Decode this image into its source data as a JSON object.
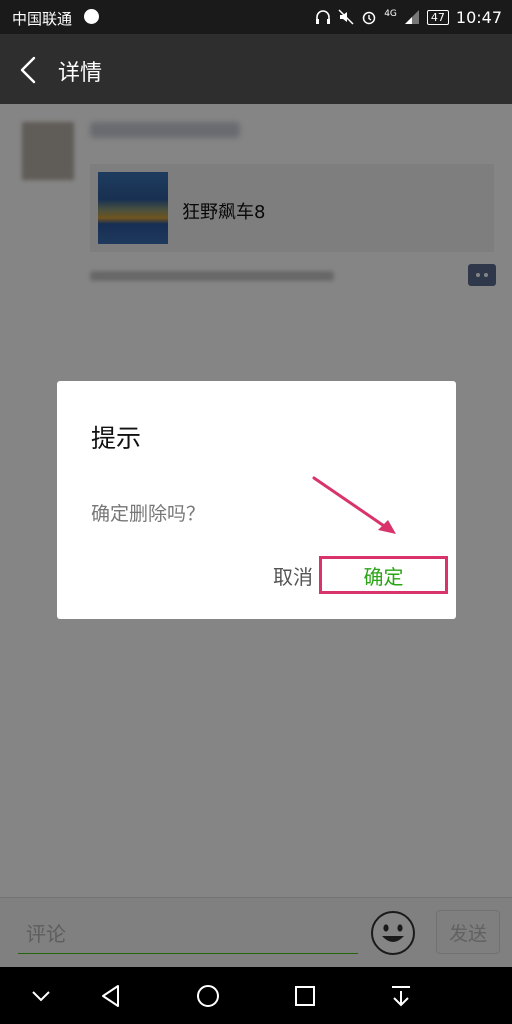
{
  "status_bar": {
    "carrier": "中国联通",
    "network_label": "4G",
    "battery": "47",
    "time": "10:47"
  },
  "header": {
    "title": "详情",
    "back_icon": "chevron-left-icon"
  },
  "post": {
    "share_title": "狂野飙车8"
  },
  "input_bar": {
    "placeholder": "评论",
    "send_label": "发送",
    "emoji_icon": "smiley-icon"
  },
  "dialog": {
    "title": "提示",
    "message": "确定删除吗？",
    "cancel_label": "取消",
    "confirm_label": "确定"
  },
  "colors": {
    "header_bg": "#2e2e2e",
    "confirm_text": "#2aa515",
    "highlight": "#d8336a",
    "input_underline": "#45c01a"
  },
  "nav_bar": {
    "icons": [
      "chevron-down-icon",
      "back-triangle-icon",
      "home-circle-icon",
      "recents-square-icon",
      "notification-pull-icon"
    ]
  }
}
